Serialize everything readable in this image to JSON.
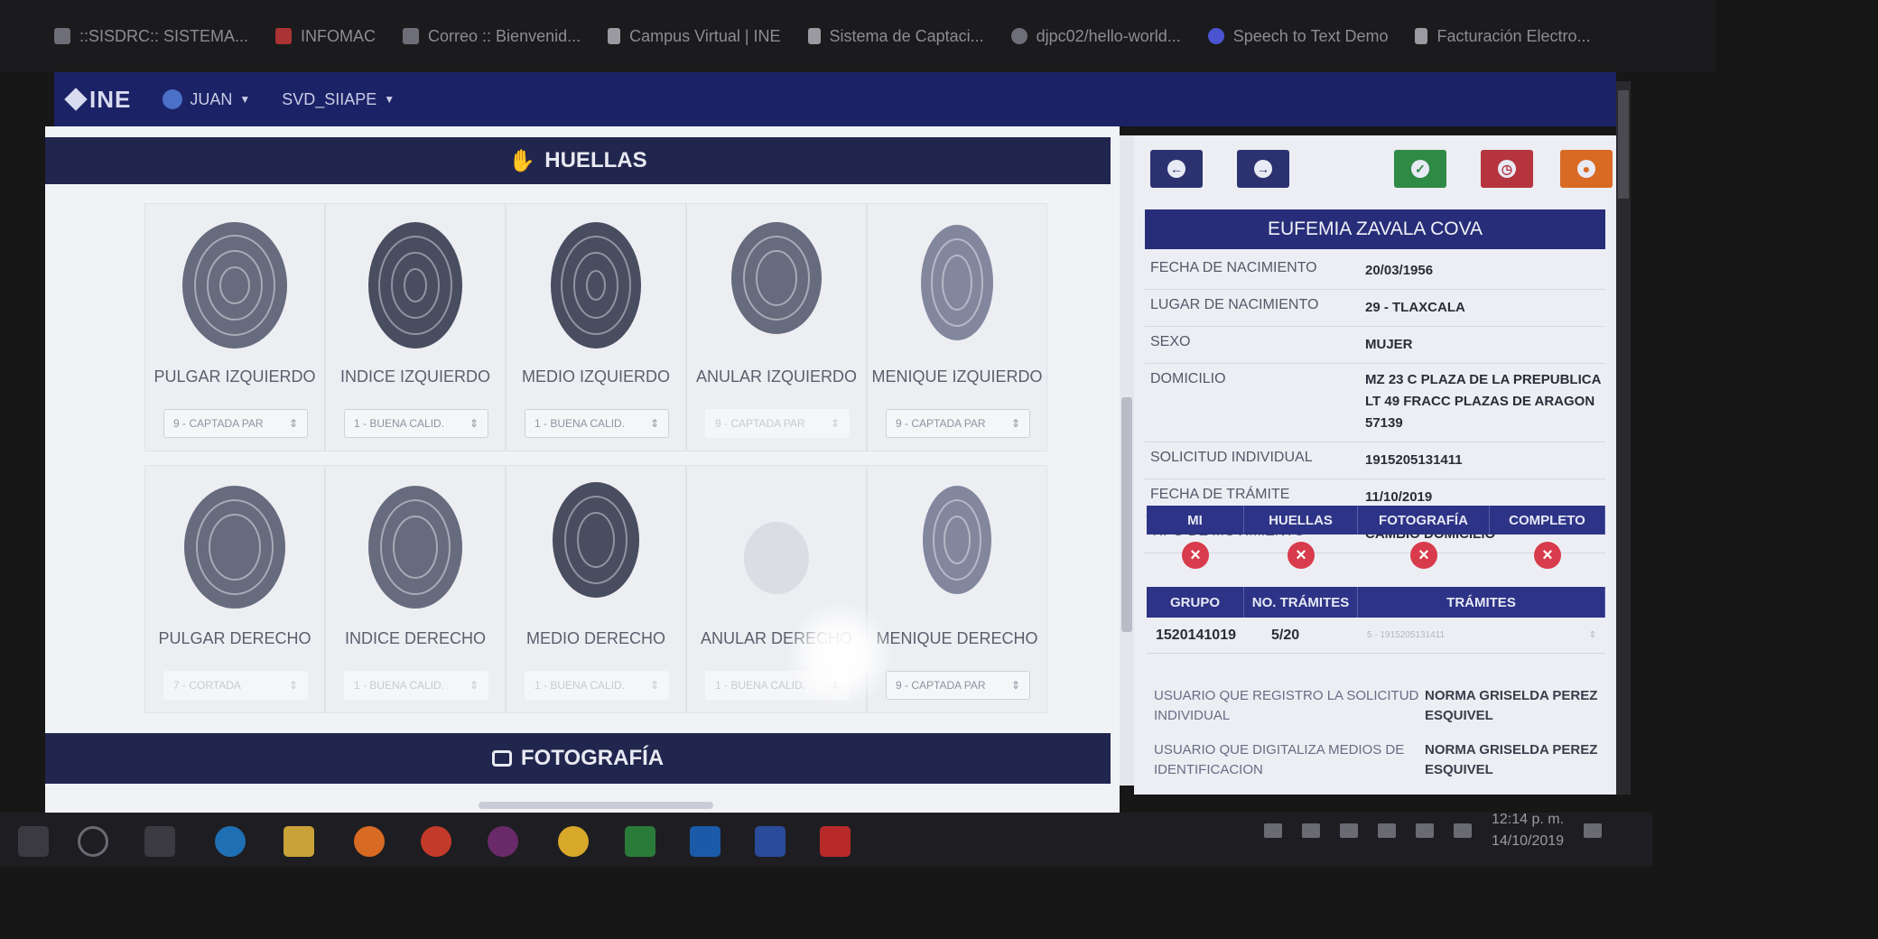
{
  "bookmarks": [
    {
      "label": "::SISDRC:: SISTEMA...",
      "icon": "globe-icon"
    },
    {
      "label": "INFOMAC",
      "icon": "infomac-icon"
    },
    {
      "label": "Correo :: Bienvenid...",
      "icon": "mail-icon"
    },
    {
      "label": "Campus Virtual | INE",
      "icon": "document-icon"
    },
    {
      "label": "Sistema de Captaci...",
      "icon": "document-icon"
    },
    {
      "label": "djpc02/hello-world...",
      "icon": "github-icon"
    },
    {
      "label": "Speech to Text Demo",
      "icon": "speech-icon"
    },
    {
      "label": "Facturación Electro...",
      "icon": "document-icon"
    }
  ],
  "header": {
    "logo": "INE",
    "user_menu": "JUAN",
    "system_menu": "SVD_SIIAPE"
  },
  "huellas": {
    "title": "HUELLAS",
    "left_hand": [
      {
        "label": "PULGAR IZQUIERDO",
        "quality": "9 - CAPTADA PAR"
      },
      {
        "label": "INDICE IZQUIERDO",
        "quality": "1 - BUENA CALID."
      },
      {
        "label": "MEDIO IZQUIERDO",
        "quality": "1 - BUENA CALID."
      },
      {
        "label": "ANULAR IZQUIERDO",
        "quality": "9 - CAPTADA PAR"
      },
      {
        "label": "MENIQUE IZQUIERDO",
        "quality": "9 - CAPTADA PAR"
      }
    ],
    "right_hand": [
      {
        "label": "PULGAR DERECHO",
        "quality": "7 - CORTADA"
      },
      {
        "label": "INDICE DERECHO",
        "quality": "1 - BUENA CALID."
      },
      {
        "label": "MEDIO DERECHO",
        "quality": "1 - BUENA CALID."
      },
      {
        "label": "ANULAR DERECHO",
        "quality": "1 - BUENA CALID."
      },
      {
        "label": "MENIQUE DERECHO",
        "quality": "9 - CAPTADA PAR"
      }
    ]
  },
  "fotografia": {
    "title": "FOTOGRAFÍA"
  },
  "toolbar": {
    "prev_icon": "arrow-left-icon",
    "next_icon": "arrow-right-icon",
    "ok_icon": "check-icon",
    "clock_icon": "clock-icon",
    "stop_icon": "stop-icon"
  },
  "person": {
    "name": "EUFEMIA ZAVALA COVA",
    "fields": [
      {
        "key": "FECHA DE NACIMIENTO",
        "value": "20/03/1956"
      },
      {
        "key": "LUGAR DE NACIMIENTO",
        "value": "29 - TLAXCALA"
      },
      {
        "key": "SEXO",
        "value": "MUJER"
      },
      {
        "key": "DOMICILIO",
        "value": "MZ 23 C PLAZA DE LA PREPUBLICA LT 49 FRACC PLAZAS DE ARAGON 57139"
      },
      {
        "key": "SOLICITUD INDIVIDUAL",
        "value": "1915205131411"
      },
      {
        "key": "FECHA DE TRÁMITE",
        "value": "11/10/2019"
      },
      {
        "key": "TIPO DE MOVIMIENTO",
        "value": "CAMBIO DOMICILIO"
      }
    ]
  },
  "status": {
    "headers": [
      "MI",
      "HUELLAS",
      "FOTOGRAFÍA",
      "COMPLETO"
    ],
    "values": [
      "incomplete",
      "incomplete",
      "incomplete",
      "incomplete"
    ]
  },
  "grupo": {
    "headers": [
      "GRUPO",
      "NO. TRÁMITES",
      "TRÁMITES"
    ],
    "row": {
      "grupo": "1520141019",
      "no_tramites": "5/20",
      "tramites": "5 - 1915205131411"
    }
  },
  "usuarios": [
    {
      "key": "USUARIO QUE REGISTRO LA SOLICITUD INDIVIDUAL",
      "value": "NORMA GRISELDA PEREZ ESQUIVEL"
    },
    {
      "key": "USUARIO QUE DIGITALIZA MEDIOS DE IDENTIFICACION",
      "value": "NORMA GRISELDA PEREZ ESQUIVEL"
    }
  ],
  "taskbar": {
    "time": "12:14 p. m.",
    "date": "14/10/2019"
  },
  "colors": {
    "header_bg": "#1c2266",
    "section_bar": "#20264d",
    "name_bar": "#272d78",
    "ok_button": "#2f8a46",
    "clock_button": "#b5343e",
    "stop_button": "#d86a24",
    "status_icon": "#d83b4b"
  }
}
